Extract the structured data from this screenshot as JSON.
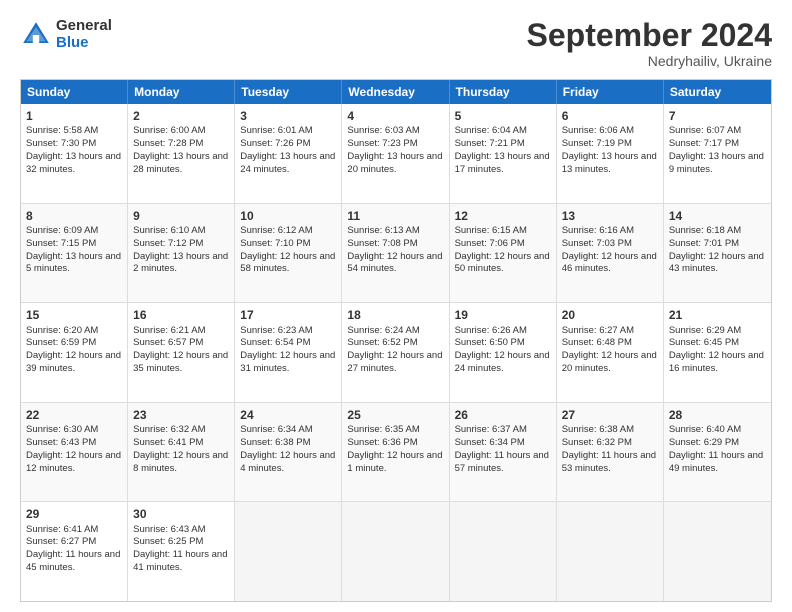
{
  "header": {
    "logo": {
      "general": "General",
      "blue": "Blue"
    },
    "title": "September 2024",
    "location": "Nedryhailiv, Ukraine"
  },
  "calendar": {
    "weekdays": [
      "Sunday",
      "Monday",
      "Tuesday",
      "Wednesday",
      "Thursday",
      "Friday",
      "Saturday"
    ],
    "rows": [
      [
        {
          "day": "",
          "empty": true
        },
        {
          "day": "",
          "empty": true
        },
        {
          "day": "",
          "empty": true
        },
        {
          "day": "",
          "empty": true
        },
        {
          "day": "",
          "empty": true
        },
        {
          "day": "",
          "empty": true
        },
        {
          "day": "",
          "empty": true
        }
      ],
      [
        {
          "day": "1",
          "sunrise": "5:58 AM",
          "sunset": "7:30 PM",
          "daylight": "13 hours and 32 minutes."
        },
        {
          "day": "2",
          "sunrise": "6:00 AM",
          "sunset": "7:28 PM",
          "daylight": "13 hours and 28 minutes."
        },
        {
          "day": "3",
          "sunrise": "6:01 AM",
          "sunset": "7:26 PM",
          "daylight": "13 hours and 24 minutes."
        },
        {
          "day": "4",
          "sunrise": "6:03 AM",
          "sunset": "7:23 PM",
          "daylight": "13 hours and 20 minutes."
        },
        {
          "day": "5",
          "sunrise": "6:04 AM",
          "sunset": "7:21 PM",
          "daylight": "13 hours and 17 minutes."
        },
        {
          "day": "6",
          "sunrise": "6:06 AM",
          "sunset": "7:19 PM",
          "daylight": "13 hours and 13 minutes."
        },
        {
          "day": "7",
          "sunrise": "6:07 AM",
          "sunset": "7:17 PM",
          "daylight": "13 hours and 9 minutes."
        }
      ],
      [
        {
          "day": "8",
          "sunrise": "6:09 AM",
          "sunset": "7:15 PM",
          "daylight": "13 hours and 5 minutes."
        },
        {
          "day": "9",
          "sunrise": "6:10 AM",
          "sunset": "7:12 PM",
          "daylight": "13 hours and 2 minutes."
        },
        {
          "day": "10",
          "sunrise": "6:12 AM",
          "sunset": "7:10 PM",
          "daylight": "12 hours and 58 minutes."
        },
        {
          "day": "11",
          "sunrise": "6:13 AM",
          "sunset": "7:08 PM",
          "daylight": "12 hours and 54 minutes."
        },
        {
          "day": "12",
          "sunrise": "6:15 AM",
          "sunset": "7:06 PM",
          "daylight": "12 hours and 50 minutes."
        },
        {
          "day": "13",
          "sunrise": "6:16 AM",
          "sunset": "7:03 PM",
          "daylight": "12 hours and 46 minutes."
        },
        {
          "day": "14",
          "sunrise": "6:18 AM",
          "sunset": "7:01 PM",
          "daylight": "12 hours and 43 minutes."
        }
      ],
      [
        {
          "day": "15",
          "sunrise": "6:20 AM",
          "sunset": "6:59 PM",
          "daylight": "12 hours and 39 minutes."
        },
        {
          "day": "16",
          "sunrise": "6:21 AM",
          "sunset": "6:57 PM",
          "daylight": "12 hours and 35 minutes."
        },
        {
          "day": "17",
          "sunrise": "6:23 AM",
          "sunset": "6:54 PM",
          "daylight": "12 hours and 31 minutes."
        },
        {
          "day": "18",
          "sunrise": "6:24 AM",
          "sunset": "6:52 PM",
          "daylight": "12 hours and 27 minutes."
        },
        {
          "day": "19",
          "sunrise": "6:26 AM",
          "sunset": "6:50 PM",
          "daylight": "12 hours and 24 minutes."
        },
        {
          "day": "20",
          "sunrise": "6:27 AM",
          "sunset": "6:48 PM",
          "daylight": "12 hours and 20 minutes."
        },
        {
          "day": "21",
          "sunrise": "6:29 AM",
          "sunset": "6:45 PM",
          "daylight": "12 hours and 16 minutes."
        }
      ],
      [
        {
          "day": "22",
          "sunrise": "6:30 AM",
          "sunset": "6:43 PM",
          "daylight": "12 hours and 12 minutes."
        },
        {
          "day": "23",
          "sunrise": "6:32 AM",
          "sunset": "6:41 PM",
          "daylight": "12 hours and 8 minutes."
        },
        {
          "day": "24",
          "sunrise": "6:34 AM",
          "sunset": "6:38 PM",
          "daylight": "12 hours and 4 minutes."
        },
        {
          "day": "25",
          "sunrise": "6:35 AM",
          "sunset": "6:36 PM",
          "daylight": "12 hours and 1 minute."
        },
        {
          "day": "26",
          "sunrise": "6:37 AM",
          "sunset": "6:34 PM",
          "daylight": "11 hours and 57 minutes."
        },
        {
          "day": "27",
          "sunrise": "6:38 AM",
          "sunset": "6:32 PM",
          "daylight": "11 hours and 53 minutes."
        },
        {
          "day": "28",
          "sunrise": "6:40 AM",
          "sunset": "6:29 PM",
          "daylight": "11 hours and 49 minutes."
        }
      ],
      [
        {
          "day": "29",
          "sunrise": "6:41 AM",
          "sunset": "6:27 PM",
          "daylight": "11 hours and 45 minutes."
        },
        {
          "day": "30",
          "sunrise": "6:43 AM",
          "sunset": "6:25 PM",
          "daylight": "11 hours and 41 minutes."
        },
        {
          "day": "",
          "empty": true
        },
        {
          "day": "",
          "empty": true
        },
        {
          "day": "",
          "empty": true
        },
        {
          "day": "",
          "empty": true
        },
        {
          "day": "",
          "empty": true
        }
      ]
    ]
  }
}
